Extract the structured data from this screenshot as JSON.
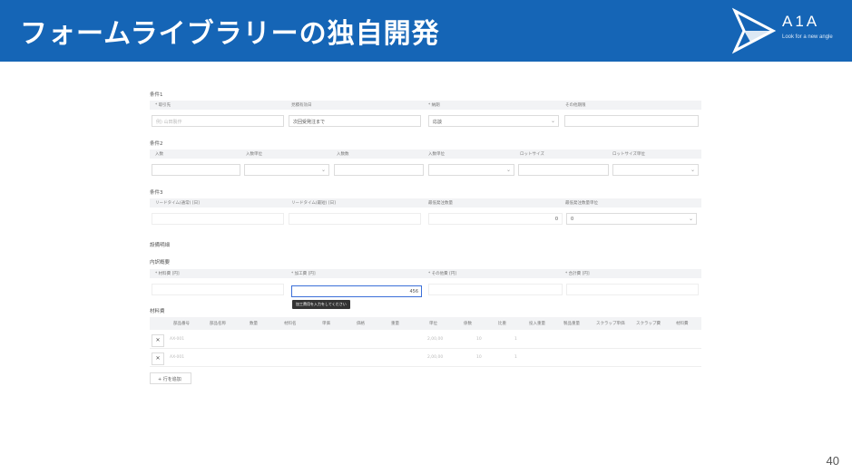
{
  "header": {
    "title": "フォームライブラリーの独自開発"
  },
  "logo": {
    "brand": "A1A",
    "tagline": "Look for a new angle"
  },
  "page_number": "40",
  "form": {
    "section1": {
      "label": "条件1",
      "headers": [
        "* 取引先",
        "見積有効日",
        "* 納期",
        "その他期限"
      ],
      "values": {
        "customer_placeholder": "例) 山田製作",
        "valid_until": "次回受発注まで",
        "delivery": "応談"
      }
    },
    "section2": {
      "label": "条件2",
      "headers": [
        "入数",
        "入数単位",
        "入数数",
        "入数単位",
        "ロットサイズ",
        "ロットサイズ単位"
      ]
    },
    "section3": {
      "label": "条件3",
      "headers": [
        "リードタイム(通常) [日]",
        "リードタイム(最短) [日]",
        "最低発注数量",
        "最低発注数量単位"
      ],
      "values": {
        "min_order_qty": "0",
        "min_order_unit": "0"
      }
    },
    "equipment_label": "設備明細",
    "breakdown": {
      "label": "内訳概要",
      "headers": [
        "* 材料費 [円]",
        "* 加工費 [円]",
        "* その他費 [円]",
        "* 合計費 [円]"
      ],
      "processing_value": "456",
      "tooltip": "加工費用を入力をしてください"
    },
    "materials": {
      "label": "材料費",
      "headers": [
        "部品番号",
        "部品名称",
        "数量",
        "材料名",
        "単価",
        "価格",
        "重量",
        "単位",
        "係数",
        "比重",
        "投入重量",
        "製品重量",
        "スクラップ単価",
        "スクラップ費",
        "材料費"
      ],
      "rows": [
        {
          "part_no": "AX-001",
          "price": "2,00,00",
          "weight": "10",
          "unit": "1"
        },
        {
          "part_no": "AX-001",
          "price": "2,00,00",
          "weight": "10",
          "unit": "1"
        }
      ],
      "add_row_label": "行を追加"
    }
  }
}
